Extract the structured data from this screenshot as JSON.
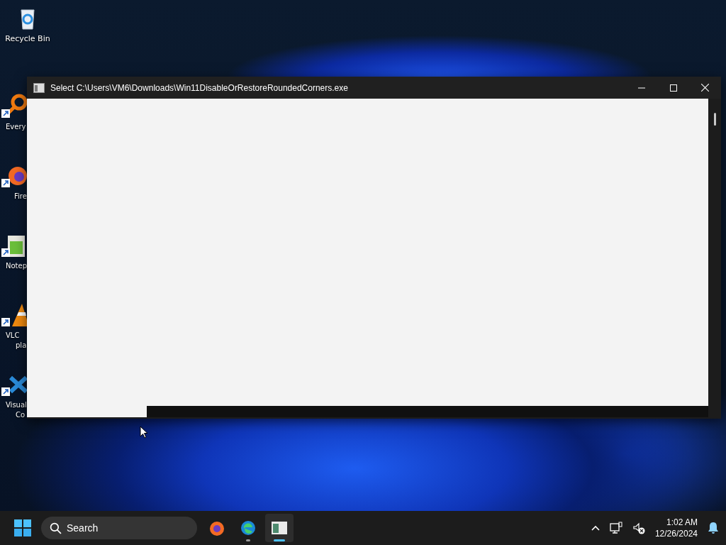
{
  "desktop": {
    "icons": [
      {
        "kind": "recycle",
        "lines": [
          "Recycle Bin"
        ],
        "shortcut": false
      },
      {
        "kind": "everything",
        "lines": [
          "Every"
        ],
        "shortcut": true
      },
      {
        "kind": "firefox",
        "lines": [
          "Fire"
        ],
        "shortcut": true
      },
      {
        "kind": "notepad",
        "lines": [
          "Notep"
        ],
        "shortcut": true
      },
      {
        "kind": "vlc",
        "lines": [
          "VLC",
          "pla"
        ],
        "shortcut": true
      },
      {
        "kind": "vscode",
        "lines": [
          "Visual",
          "Co"
        ],
        "shortcut": true
      }
    ]
  },
  "window": {
    "title": "Select C:\\Users\\VM6\\Downloads\\Win11DisableOrRestoreRoundedCorners.exe"
  },
  "taskbar": {
    "search": {
      "placeholder": "Search"
    },
    "apps": [
      {
        "kind": "firefox",
        "running": false,
        "selected": false
      },
      {
        "kind": "edge",
        "running": true,
        "selected": false
      },
      {
        "kind": "console",
        "running": true,
        "selected": true
      }
    ],
    "clock": {
      "time": "1:02 AM",
      "date": "12/26/2024"
    }
  }
}
